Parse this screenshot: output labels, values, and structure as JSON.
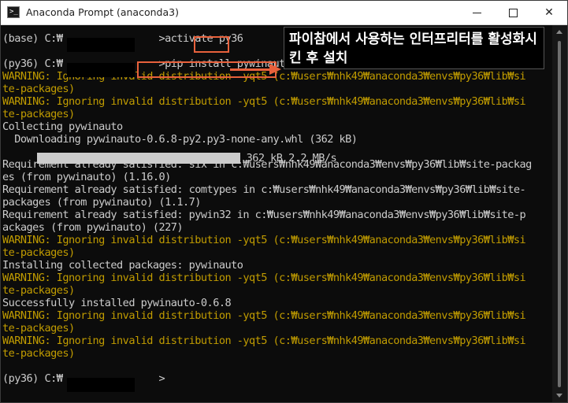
{
  "window": {
    "title": "Anaconda Prompt (anaconda3)",
    "minimize_glyph": "—",
    "maximize_glyph": "☐",
    "close_glyph": "✕"
  },
  "console": {
    "lines": [
      {
        "text": "(base) C:₩                >activate py36",
        "kind": "default"
      },
      {
        "text": "",
        "kind": "default"
      },
      {
        "text": "(py36) C:₩                >pip install pywinauto",
        "kind": "default"
      },
      {
        "text": "WARNING: Ignoring invalid distribution -yqt5 (c:₩users₩nhk49₩anaconda3₩envs₩py36₩lib₩si",
        "kind": "warn"
      },
      {
        "text": "te-packages)",
        "kind": "warn"
      },
      {
        "text": "WARNING: Ignoring invalid distribution -yqt5 (c:₩users₩nhk49₩anaconda3₩envs₩py36₩lib₩si",
        "kind": "warn"
      },
      {
        "text": "te-packages)",
        "kind": "warn"
      },
      {
        "text": "Collecting pywinauto",
        "kind": "default"
      },
      {
        "text": "  Downloading pywinauto-0.6.8-py2.py3-none-any.whl (362 kB)",
        "kind": "default"
      },
      {
        "text": "",
        "kind": "default"
      },
      {
        "text": "Requirement already satisfied: six in c:₩users₩nhk49₩anaconda3₩envs₩py36₩lib₩site-packag",
        "kind": "default"
      },
      {
        "text": "es (from pywinauto) (1.16.0)",
        "kind": "default"
      },
      {
        "text": "Requirement already satisfied: comtypes in c:₩users₩nhk49₩anaconda3₩envs₩py36₩lib₩site-",
        "kind": "default"
      },
      {
        "text": "packages (from pywinauto) (1.1.7)",
        "kind": "default"
      },
      {
        "text": "Requirement already satisfied: pywin32 in c:₩users₩nhk49₩anaconda3₩envs₩py36₩lib₩site-p",
        "kind": "default"
      },
      {
        "text": "ackages (from pywinauto) (227)",
        "kind": "default"
      },
      {
        "text": "WARNING: Ignoring invalid distribution -yqt5 (c:₩users₩nhk49₩anaconda3₩envs₩py36₩lib₩si",
        "kind": "warn"
      },
      {
        "text": "te-packages)",
        "kind": "warn"
      },
      {
        "text": "Installing collected packages: pywinauto",
        "kind": "default"
      },
      {
        "text": "WARNING: Ignoring invalid distribution -yqt5 (c:₩users₩nhk49₩anaconda3₩envs₩py36₩lib₩si",
        "kind": "warn"
      },
      {
        "text": "te-packages)",
        "kind": "warn"
      },
      {
        "text": "Successfully installed pywinauto-0.6.8",
        "kind": "default"
      },
      {
        "text": "WARNING: Ignoring invalid distribution -yqt5 (c:₩users₩nhk49₩anaconda3₩envs₩py36₩lib₩si",
        "kind": "warn"
      },
      {
        "text": "te-packages)",
        "kind": "warn"
      },
      {
        "text": "WARNING: Ignoring invalid distribution -yqt5 (c:₩users₩nhk49₩anaconda3₩envs₩py36₩lib₩si",
        "kind": "warn"
      },
      {
        "text": "te-packages)",
        "kind": "warn"
      },
      {
        "text": "",
        "kind": "default"
      },
      {
        "text": "(py36) C:₩                >",
        "kind": "default"
      }
    ],
    "progress": {
      "fraction": 1.0,
      "tail_text": " 362 kB 2.2 MB/s"
    }
  },
  "annotation": {
    "text": "파이참에서 사용하는 인터프리터를 활성화시킨 후 설치"
  },
  "colors": {
    "console_bg": "#0c0c0c",
    "console_text": "#cccccc",
    "warning_text": "#c19c00",
    "highlight": "#e8613c"
  },
  "icons": {
    "app": "terminal-icon",
    "minimize": "minimize-icon",
    "maximize": "maximize-icon",
    "close": "close-icon"
  }
}
